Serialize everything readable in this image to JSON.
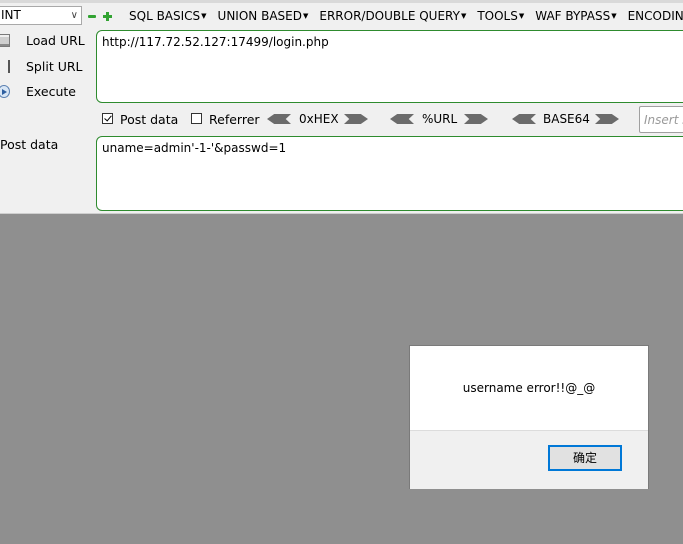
{
  "version_select": {
    "value": "INT"
  },
  "menu": {
    "items": [
      "SQL BASICS",
      "UNION BASED",
      "ERROR/DOUBLE QUERY",
      "TOOLS",
      "WAF BYPASS",
      "ENCODING"
    ]
  },
  "actions": {
    "load_url": "Load URL",
    "split_url": "Split URL",
    "execute": "Execute"
  },
  "url": {
    "value": "http://117.72.52.127:17499/login.php"
  },
  "options": {
    "post_data": {
      "label": "Post data",
      "checked": true
    },
    "referrer": {
      "label": "Referrer",
      "checked": false
    },
    "hex": "0xHEX",
    "url_enc": "%URL",
    "base64": "BASE64",
    "insert_placeholder": "Insert s"
  },
  "post": {
    "label": "Post data",
    "value": "uname=admin'-1-'&passwd=1"
  },
  "dialog": {
    "message": "username error!!@_@",
    "ok_label": "确定"
  }
}
